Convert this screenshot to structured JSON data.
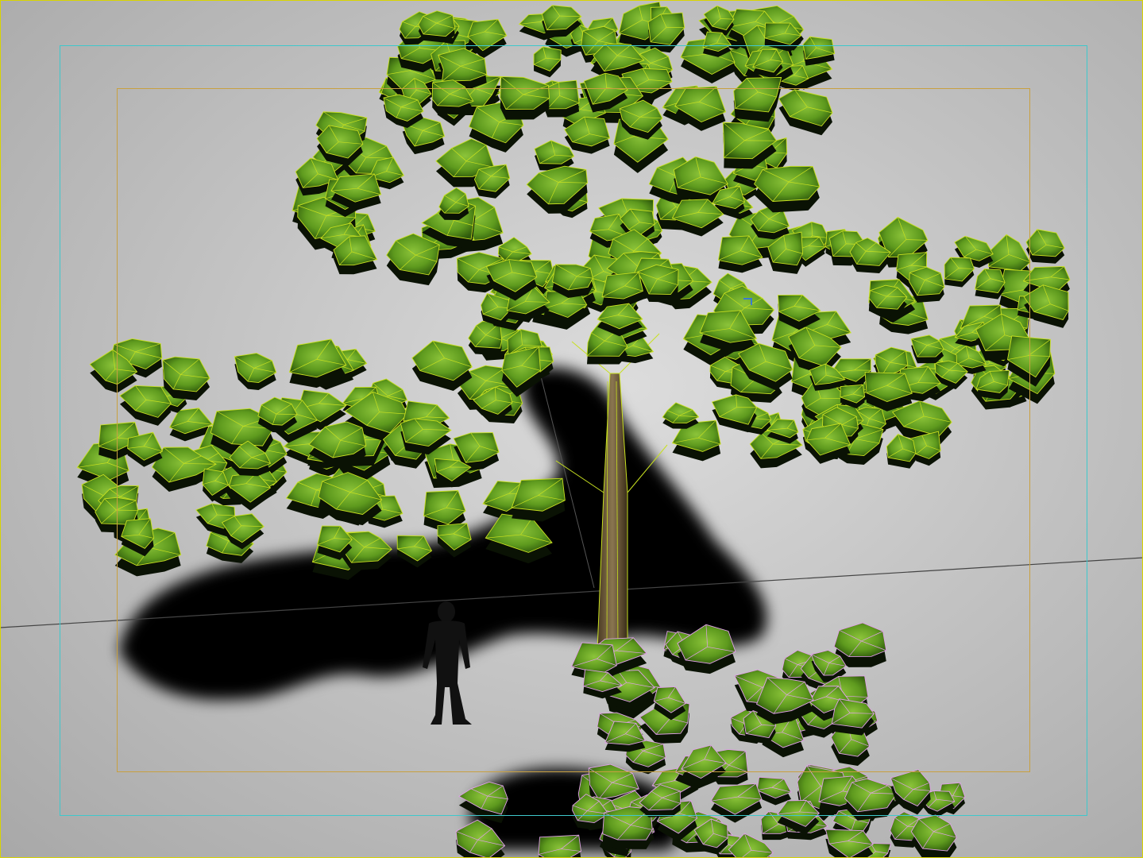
{
  "viewport": {
    "label": "",
    "colors": {
      "border": "#d8d400",
      "safe_frame_action": "#3ec8cc",
      "safe_frame_title": "#c8a040",
      "tree_wire": "#c8e020",
      "shrub_wire": "#e0a0e8",
      "leaf_fill": "#5e9a1e",
      "shadow": "#000000",
      "ground_line": "#444444"
    }
  },
  "scene": {
    "objects": [
      {
        "name": "tree",
        "selected": true,
        "wire_color": "#c8e020"
      },
      {
        "name": "shrub",
        "selected": false,
        "wire_color": "#e0a0e8"
      },
      {
        "name": "human-scale-figure",
        "selected": false
      }
    ],
    "icons": [
      "viewport-gizmo-icon"
    ]
  }
}
